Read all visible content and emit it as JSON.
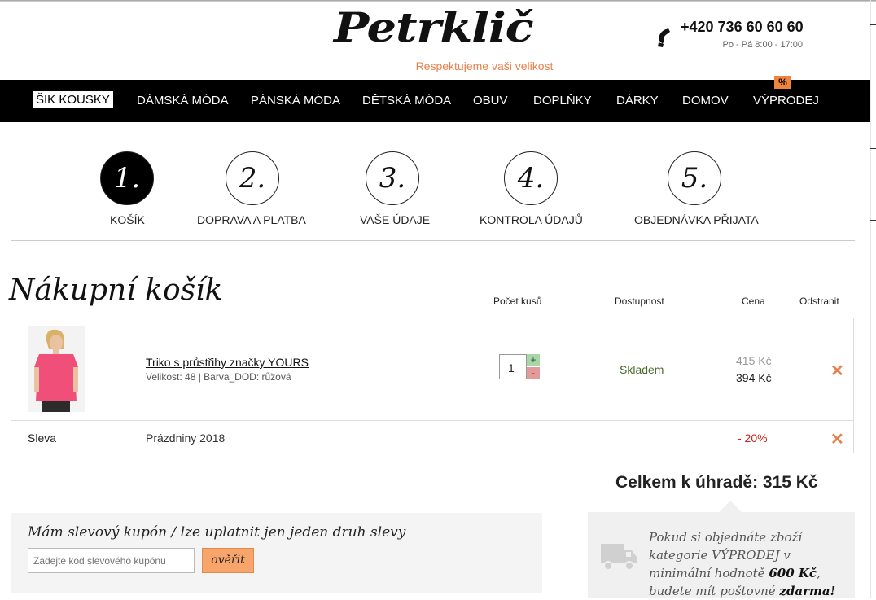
{
  "header": {
    "logo": "Petrklič",
    "tagline": "Respektujeme vaši velikost",
    "phone": "+420 736 60 60 60",
    "hours": "Po - Pá 8:00 - 17:00"
  },
  "nav": {
    "items": [
      "ŠIK KOUSKY",
      "DÁMSKÁ MÓDA",
      "PÁNSKÁ MÓDA",
      "DĚTSKÁ MÓDA",
      "OBUV",
      "DOPLŇKY",
      "DÁRKY",
      "DOMOV",
      "VÝPRODEJ"
    ],
    "active_item": "ŠIK KOUSKY",
    "sale_badge": "%"
  },
  "steps": [
    {
      "number": "1.",
      "label": "KOŠÍK",
      "active": true
    },
    {
      "number": "2.",
      "label": "DOPRAVA A PLATBA",
      "active": false
    },
    {
      "number": "3.",
      "label": "VAŠE ÚDAJE",
      "active": false
    },
    {
      "number": "4.",
      "label": "KONTROLA ÚDAJŮ",
      "active": false
    },
    {
      "number": "5.",
      "label": "OBJEDNÁVKA PŘIJATA",
      "active": false
    }
  ],
  "cart": {
    "title": "Nákupní košík",
    "columns": {
      "qty": "Počet kusů",
      "availability": "Dostupnost",
      "price": "Cena",
      "remove": "Odstranit"
    },
    "item": {
      "name": "Triko s průstřihy značky YOURS",
      "meta": "Velikost: 48 | Barva_DOD: růžová",
      "quantity": "1",
      "plus": "+",
      "minus": "-",
      "availability": "Skladem",
      "old_price": "415 Kč",
      "price": "394 Kč",
      "remove_symbol": "✕"
    },
    "discount": {
      "label": "Sleva",
      "name": "Prázdniny 2018",
      "value": "- 20%",
      "remove_symbol": "✕"
    },
    "total": "Celkem k úhradě: 315 Kč"
  },
  "coupon": {
    "title": "Mám slevový kupón / lze uplatnit jen jeden druh slevy",
    "placeholder": "Zadejte kód slevového kupónu",
    "button": "ověřit"
  },
  "shipping": {
    "text_pre": "Pokud si objednáte zboží kategorie VÝPRODEJ v minimální hodnotě ",
    "amount": "600 Kč",
    "text_mid": ", budete mít poštovné ",
    "free": "zdarma!"
  },
  "colors": {
    "accent": "#e8804a",
    "nav_bg": "#000000",
    "price_discount": "#d0221c",
    "availability": "#4a6a2a"
  }
}
